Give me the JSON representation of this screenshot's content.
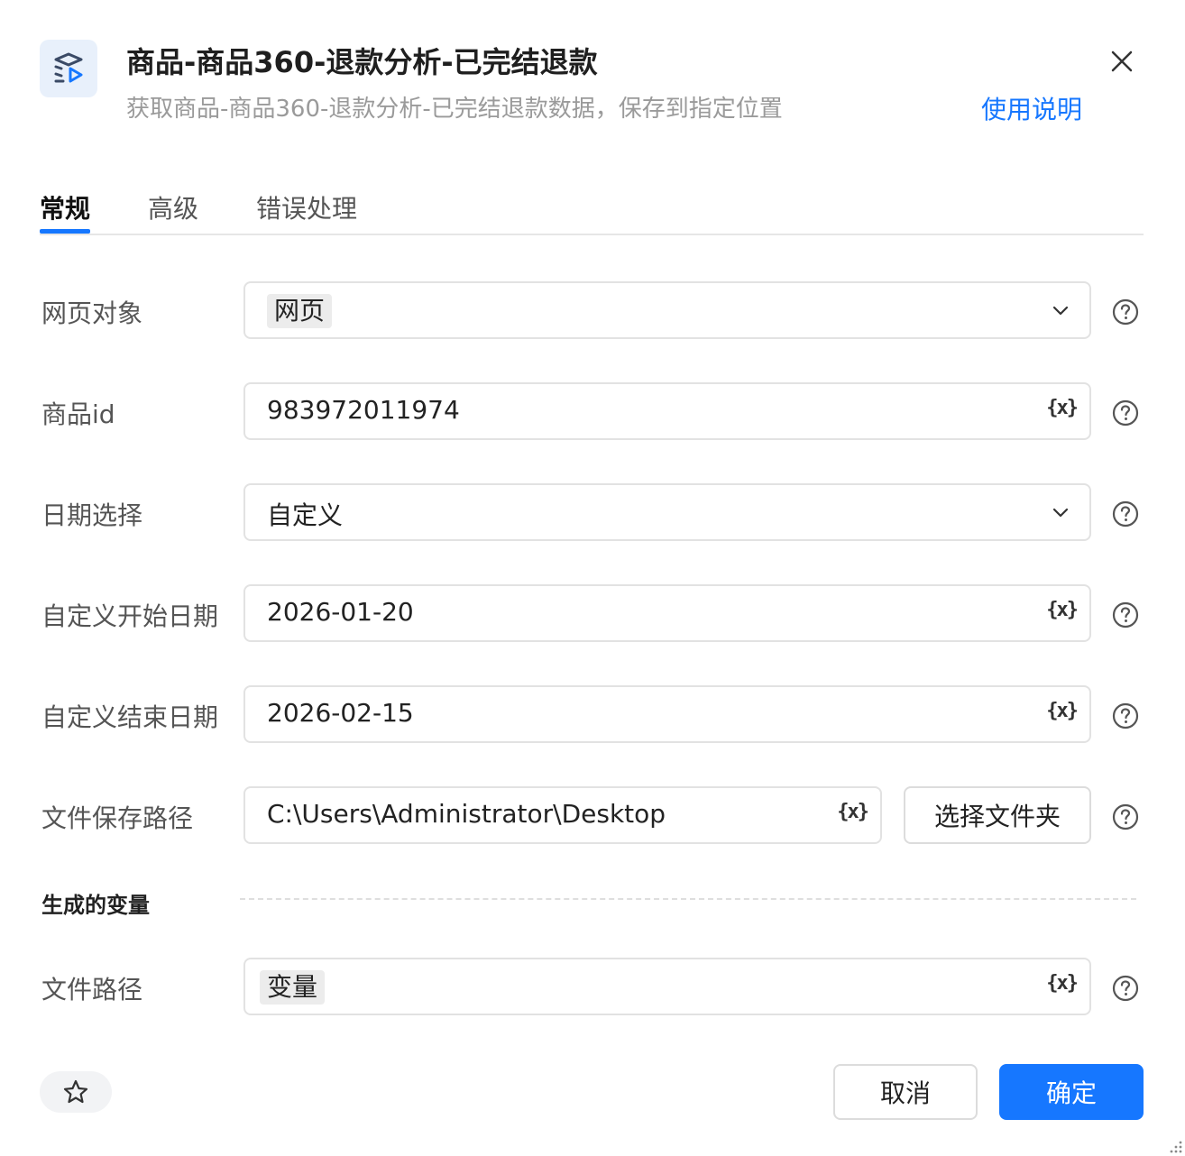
{
  "header": {
    "title": "商品-商品360-退款分析-已完结退款",
    "subtitle": "获取商品-商品360-退款分析-已完结退款数据，保存到指定位置",
    "help_link": "使用说明",
    "icon": "layers-play-icon"
  },
  "tabs": [
    {
      "label": "常规",
      "active": true
    },
    {
      "label": "高级",
      "active": false
    },
    {
      "label": "错误处理",
      "active": false
    }
  ],
  "form": {
    "webpage_object": {
      "label": "网页对象",
      "value": "网页"
    },
    "product_id": {
      "label": "商品id",
      "value": "983972011974"
    },
    "date_select": {
      "label": "日期选择",
      "value": "自定义"
    },
    "custom_start": {
      "label": "自定义开始日期",
      "value": "2026-01-20"
    },
    "custom_end": {
      "label": "自定义结束日期",
      "value": "2026-02-15"
    },
    "save_path": {
      "label": "文件保存路径",
      "value": "C:\\Users\\Administrator\\Desktop",
      "button": "选择文件夹"
    }
  },
  "variable_icon_text": "{x}",
  "generated": {
    "section_title": "生成的变量",
    "file_path": {
      "label": "文件路径",
      "value": "变量"
    }
  },
  "footer": {
    "cancel": "取消",
    "confirm": "确定"
  },
  "colors": {
    "accent": "#1677ff",
    "chip_bg": "#ececec"
  }
}
